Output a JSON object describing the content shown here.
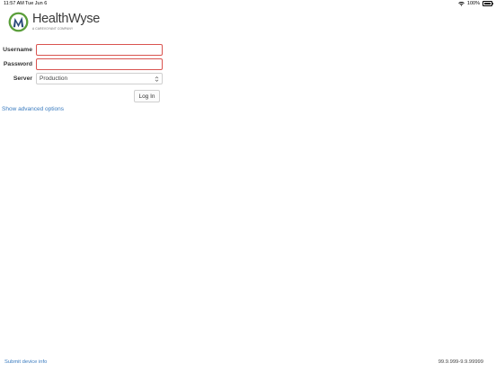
{
  "status_bar": {
    "time": "11:57 AM",
    "date": "Tue Jun 6",
    "battery": "100%"
  },
  "logo": {
    "name": "HealthWyse",
    "tagline": "A CAREVOYANT COMPANY",
    "icon": "healthwyse-logo-mark",
    "colors": {
      "green": "#5a9e3a",
      "navy": "#2b4a7a"
    }
  },
  "form": {
    "username_label": "Username",
    "username_value": "",
    "password_label": "Password",
    "password_value": "",
    "server_label": "Server",
    "server_selected": "Production",
    "login_label": "Log In",
    "advanced_link": "Show advanced options",
    "error_color": "#d9534f"
  },
  "footer": {
    "submit_link": "Submit device info",
    "version": "99.9.999-9.9.99999"
  }
}
